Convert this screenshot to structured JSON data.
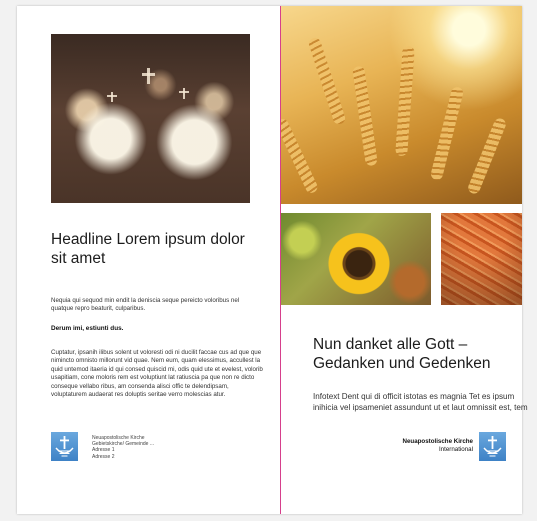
{
  "left_page": {
    "headline": "Headline Lorem ipsum dolor sit amet",
    "intro": "Nequia qui sequod min endit la deniscia seque pereicto voloribus nel quatque repro beaturit, culparibus.",
    "subhead": "Derum imi, estiunti dus.",
    "body": "Cuptatur, ipsanih ilibus solent ut voloresti odi ni ducilit faccae cus ad que que nimincto omnisto millorunt vid quae. Nem eum, quam elessimus, accullest la quid untemod itaeria id qui consed quiscid mi, odis quid ute et evelest, volorib usapitiam, cone moloris rem est voluptiunt lat ratiuscia pa que non re dicto conseque vellabo ribus, am consenda alisci offic te delendipsam, voluptaturem audaerat res doluptis seritae verro molescias atur.",
    "address": [
      "Neuapostolische Kirche",
      "Gebietskirche/ Gemeinde ...",
      "Adresse 1",
      "Adresse 2"
    ]
  },
  "right_page": {
    "headline": "Nun danket alle Gott – Gedanken und Gedenken",
    "info": "Infotext Dent qui di officit istotas es magnia Tet es ipsum inihicia vel ipsameniet assundunt ut et laut omnissit est, tem",
    "org_name": "Neuapostolische Kirche",
    "org_sub": "International"
  },
  "colors": {
    "fold_line": "#d63f8c",
    "logo_blue": "#4a8fd0"
  }
}
